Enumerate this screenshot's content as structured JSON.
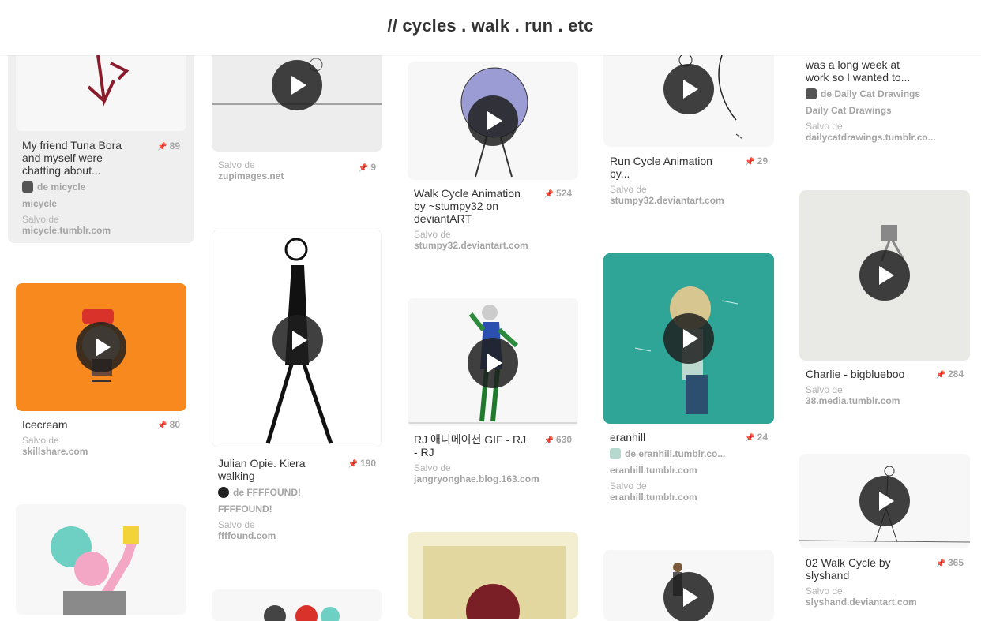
{
  "header": {
    "title": "// cycles . walk . run . etc"
  },
  "common": {
    "saved_from": "Salvo de"
  },
  "pins": {
    "micycle": {
      "desc": "My friend Tuna Bora and myself were chatting about...",
      "saves": "89",
      "attribution": "de micycle",
      "board": "micycle",
      "source": "micycle.tumblr.com"
    },
    "icecream": {
      "desc": "Icecream",
      "saves": "80",
      "source": "skillshare.com"
    },
    "zupimages": {
      "saves": "9",
      "source": "zupimages.net"
    },
    "opie": {
      "desc": "Julian Opie. Kiera walking",
      "saves": "190",
      "attribution": "de FFFFOUND!",
      "board": "FFFFOUND!",
      "source": "ffffound.com"
    },
    "walkcycle": {
      "desc": "Walk Cycle Animation by ~stumpy32 on deviantART",
      "saves": "524",
      "source": "stumpy32.deviantart.com"
    },
    "rj": {
      "desc": "RJ 애니메이션 GIF - RJ - RJ",
      "saves": "630",
      "source": "jangryonghae.blog.163.com"
    },
    "runcycle": {
      "desc": "Run Cycle Animation by...",
      "saves": "29",
      "source": "stumpy32.deviantart.com"
    },
    "eranhill": {
      "desc": "eranhill",
      "saves": "24",
      "attribution": "de eranhill.tumblr.co...",
      "board": "eranhill.tumblr.com",
      "source": "eranhill.tumblr.com"
    },
    "dailycat": {
      "desc": "was a long week at work so I wanted to...",
      "attribution": "de Daily Cat Drawings",
      "board": "Daily Cat Drawings",
      "source": "dailycatdrawings.tumblr.co..."
    },
    "charlie": {
      "desc": "Charlie - bigblueboo",
      "saves": "284",
      "source": "38.media.tumblr.com"
    },
    "walk02": {
      "desc": "02 Walk Cycle by slyshand",
      "saves": "365",
      "source": "slyshand.deviantart.com"
    }
  },
  "colors": {
    "accent_orange": "#f7891f",
    "teal": "#2ea597",
    "play_button": "#1e1e1e"
  },
  "icons": {
    "play": "play-icon",
    "pin_count": "pushpin-icon"
  }
}
